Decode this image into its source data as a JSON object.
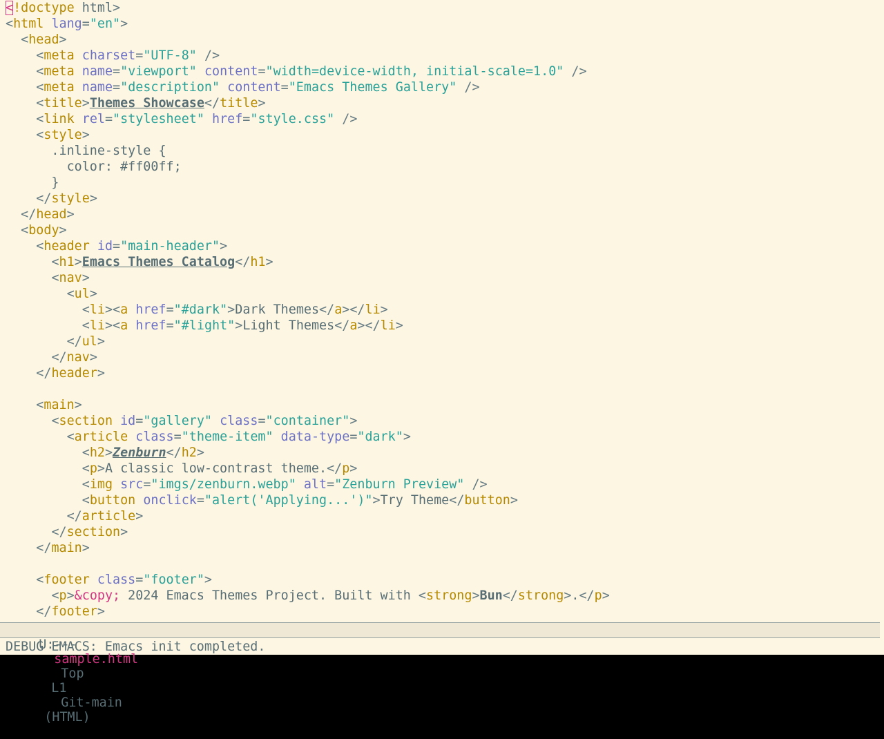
{
  "editor": {
    "lines": [
      [
        [
          "cursor",
          "<"
        ],
        [
          "tag",
          "!doctype"
        ],
        [
          "text",
          " html"
        ],
        [
          "punct",
          ">"
        ]
      ],
      [
        [
          "punct",
          "<"
        ],
        [
          "tag",
          "html"
        ],
        [
          "text",
          " "
        ],
        [
          "attr",
          "lang"
        ],
        [
          "punct",
          "="
        ],
        [
          "str",
          "\"en\""
        ],
        [
          "punct",
          ">"
        ]
      ],
      [
        [
          "text",
          "  "
        ],
        [
          "punct",
          "<"
        ],
        [
          "tag",
          "head"
        ],
        [
          "punct",
          ">"
        ]
      ],
      [
        [
          "text",
          "    "
        ],
        [
          "punct",
          "<"
        ],
        [
          "tag",
          "meta"
        ],
        [
          "text",
          " "
        ],
        [
          "attr",
          "charset"
        ],
        [
          "punct",
          "="
        ],
        [
          "str",
          "\"UTF-8\""
        ],
        [
          "text",
          " "
        ],
        [
          "punct",
          "/>"
        ]
      ],
      [
        [
          "text",
          "    "
        ],
        [
          "punct",
          "<"
        ],
        [
          "tag",
          "meta"
        ],
        [
          "text",
          " "
        ],
        [
          "attr",
          "name"
        ],
        [
          "punct",
          "="
        ],
        [
          "str",
          "\"viewport\""
        ],
        [
          "text",
          " "
        ],
        [
          "attr",
          "content"
        ],
        [
          "punct",
          "="
        ],
        [
          "str",
          "\"width=device-width, initial-scale=1.0\""
        ],
        [
          "text",
          " "
        ],
        [
          "punct",
          "/>"
        ]
      ],
      [
        [
          "text",
          "    "
        ],
        [
          "punct",
          "<"
        ],
        [
          "tag",
          "meta"
        ],
        [
          "text",
          " "
        ],
        [
          "attr",
          "name"
        ],
        [
          "punct",
          "="
        ],
        [
          "str",
          "\"description\""
        ],
        [
          "text",
          " "
        ],
        [
          "attr",
          "content"
        ],
        [
          "punct",
          "="
        ],
        [
          "str",
          "\"Emacs Themes Gallery\""
        ],
        [
          "text",
          " "
        ],
        [
          "punct",
          "/>"
        ]
      ],
      [
        [
          "text",
          "    "
        ],
        [
          "punct",
          "<"
        ],
        [
          "tag",
          "title"
        ],
        [
          "punct",
          ">"
        ],
        [
          "bu",
          "Themes Showcase"
        ],
        [
          "punct",
          "</"
        ],
        [
          "tag",
          "title"
        ],
        [
          "punct",
          ">"
        ]
      ],
      [
        [
          "text",
          "    "
        ],
        [
          "punct",
          "<"
        ],
        [
          "tag",
          "link"
        ],
        [
          "text",
          " "
        ],
        [
          "attr",
          "rel"
        ],
        [
          "punct",
          "="
        ],
        [
          "str",
          "\"stylesheet\""
        ],
        [
          "text",
          " "
        ],
        [
          "attr",
          "href"
        ],
        [
          "punct",
          "="
        ],
        [
          "str",
          "\"style.css\""
        ],
        [
          "text",
          " "
        ],
        [
          "punct",
          "/>"
        ]
      ],
      [
        [
          "text",
          "    "
        ],
        [
          "punct",
          "<"
        ],
        [
          "tag",
          "style"
        ],
        [
          "punct",
          ">"
        ]
      ],
      [
        [
          "text",
          "      .inline-style {"
        ]
      ],
      [
        [
          "text",
          "        color: #ff00ff;"
        ]
      ],
      [
        [
          "text",
          "      }"
        ]
      ],
      [
        [
          "text",
          "    "
        ],
        [
          "punct",
          "</"
        ],
        [
          "tag",
          "style"
        ],
        [
          "punct",
          ">"
        ]
      ],
      [
        [
          "text",
          "  "
        ],
        [
          "punct",
          "</"
        ],
        [
          "tag",
          "head"
        ],
        [
          "punct",
          ">"
        ]
      ],
      [
        [
          "text",
          "  "
        ],
        [
          "punct",
          "<"
        ],
        [
          "tag",
          "body"
        ],
        [
          "punct",
          ">"
        ]
      ],
      [
        [
          "text",
          "    "
        ],
        [
          "punct",
          "<"
        ],
        [
          "tag",
          "header"
        ],
        [
          "text",
          " "
        ],
        [
          "attr",
          "id"
        ],
        [
          "punct",
          "="
        ],
        [
          "str",
          "\"main-header\""
        ],
        [
          "punct",
          ">"
        ]
      ],
      [
        [
          "text",
          "      "
        ],
        [
          "punct",
          "<"
        ],
        [
          "tag",
          "h1"
        ],
        [
          "punct",
          ">"
        ],
        [
          "bu",
          "Emacs Themes Catalog"
        ],
        [
          "punct",
          "</"
        ],
        [
          "tag",
          "h1"
        ],
        [
          "punct",
          ">"
        ]
      ],
      [
        [
          "text",
          "      "
        ],
        [
          "punct",
          "<"
        ],
        [
          "tag",
          "nav"
        ],
        [
          "punct",
          ">"
        ]
      ],
      [
        [
          "text",
          "        "
        ],
        [
          "punct",
          "<"
        ],
        [
          "tag",
          "ul"
        ],
        [
          "punct",
          ">"
        ]
      ],
      [
        [
          "text",
          "          "
        ],
        [
          "punct",
          "<"
        ],
        [
          "tag",
          "li"
        ],
        [
          "punct",
          "><"
        ],
        [
          "tag",
          "a"
        ],
        [
          "text",
          " "
        ],
        [
          "attr",
          "href"
        ],
        [
          "punct",
          "="
        ],
        [
          "str",
          "\"#dark\""
        ],
        [
          "punct",
          ">"
        ],
        [
          "text",
          "Dark Themes"
        ],
        [
          "punct",
          "</"
        ],
        [
          "tag",
          "a"
        ],
        [
          "punct",
          "></"
        ],
        [
          "tag",
          "li"
        ],
        [
          "punct",
          ">"
        ]
      ],
      [
        [
          "text",
          "          "
        ],
        [
          "punct",
          "<"
        ],
        [
          "tag",
          "li"
        ],
        [
          "punct",
          "><"
        ],
        [
          "tag",
          "a"
        ],
        [
          "text",
          " "
        ],
        [
          "attr",
          "href"
        ],
        [
          "punct",
          "="
        ],
        [
          "str",
          "\"#light\""
        ],
        [
          "punct",
          ">"
        ],
        [
          "text",
          "Light Themes"
        ],
        [
          "punct",
          "</"
        ],
        [
          "tag",
          "a"
        ],
        [
          "punct",
          "></"
        ],
        [
          "tag",
          "li"
        ],
        [
          "punct",
          ">"
        ]
      ],
      [
        [
          "text",
          "        "
        ],
        [
          "punct",
          "</"
        ],
        [
          "tag",
          "ul"
        ],
        [
          "punct",
          ">"
        ]
      ],
      [
        [
          "text",
          "      "
        ],
        [
          "punct",
          "</"
        ],
        [
          "tag",
          "nav"
        ],
        [
          "punct",
          ">"
        ]
      ],
      [
        [
          "text",
          "    "
        ],
        [
          "punct",
          "</"
        ],
        [
          "tag",
          "header"
        ],
        [
          "punct",
          ">"
        ]
      ],
      [
        [
          "text",
          ""
        ]
      ],
      [
        [
          "text",
          "    "
        ],
        [
          "punct",
          "<"
        ],
        [
          "tag",
          "main"
        ],
        [
          "punct",
          ">"
        ]
      ],
      [
        [
          "text",
          "      "
        ],
        [
          "punct",
          "<"
        ],
        [
          "tag",
          "section"
        ],
        [
          "text",
          " "
        ],
        [
          "attr",
          "id"
        ],
        [
          "punct",
          "="
        ],
        [
          "str",
          "\"gallery\""
        ],
        [
          "text",
          " "
        ],
        [
          "attr",
          "class"
        ],
        [
          "punct",
          "="
        ],
        [
          "str",
          "\"container\""
        ],
        [
          "punct",
          ">"
        ]
      ],
      [
        [
          "text",
          "        "
        ],
        [
          "punct",
          "<"
        ],
        [
          "tag",
          "article"
        ],
        [
          "text",
          " "
        ],
        [
          "attr",
          "class"
        ],
        [
          "punct",
          "="
        ],
        [
          "str",
          "\"theme-item\""
        ],
        [
          "text",
          " "
        ],
        [
          "attr",
          "data-type"
        ],
        [
          "punct",
          "="
        ],
        [
          "str",
          "\"dark\""
        ],
        [
          "punct",
          ">"
        ]
      ],
      [
        [
          "text",
          "          "
        ],
        [
          "punct",
          "<"
        ],
        [
          "tag",
          "h2"
        ],
        [
          "punct",
          ">"
        ],
        [
          "bui",
          "Zenburn"
        ],
        [
          "punct",
          "</"
        ],
        [
          "tag",
          "h2"
        ],
        [
          "punct",
          ">"
        ]
      ],
      [
        [
          "text",
          "          "
        ],
        [
          "punct",
          "<"
        ],
        [
          "tag",
          "p"
        ],
        [
          "punct",
          ">"
        ],
        [
          "text",
          "A classic low-contrast theme."
        ],
        [
          "punct",
          "</"
        ],
        [
          "tag",
          "p"
        ],
        [
          "punct",
          ">"
        ]
      ],
      [
        [
          "text",
          "          "
        ],
        [
          "punct",
          "<"
        ],
        [
          "tag",
          "img"
        ],
        [
          "text",
          " "
        ],
        [
          "attr",
          "src"
        ],
        [
          "punct",
          "="
        ],
        [
          "str",
          "\"imgs/zenburn.webp\""
        ],
        [
          "text",
          " "
        ],
        [
          "attr",
          "alt"
        ],
        [
          "punct",
          "="
        ],
        [
          "str",
          "\"Zenburn Preview\""
        ],
        [
          "text",
          " "
        ],
        [
          "punct",
          "/>"
        ]
      ],
      [
        [
          "text",
          "          "
        ],
        [
          "punct",
          "<"
        ],
        [
          "tag",
          "button"
        ],
        [
          "text",
          " "
        ],
        [
          "attr",
          "onclick"
        ],
        [
          "punct",
          "="
        ],
        [
          "str",
          "\"alert('Applying...')\""
        ],
        [
          "punct",
          ">"
        ],
        [
          "text",
          "Try Theme"
        ],
        [
          "punct",
          "</"
        ],
        [
          "tag",
          "button"
        ],
        [
          "punct",
          ">"
        ]
      ],
      [
        [
          "text",
          "        "
        ],
        [
          "punct",
          "</"
        ],
        [
          "tag",
          "article"
        ],
        [
          "punct",
          ">"
        ]
      ],
      [
        [
          "text",
          "      "
        ],
        [
          "punct",
          "</"
        ],
        [
          "tag",
          "section"
        ],
        [
          "punct",
          ">"
        ]
      ],
      [
        [
          "text",
          "    "
        ],
        [
          "punct",
          "</"
        ],
        [
          "tag",
          "main"
        ],
        [
          "punct",
          ">"
        ]
      ],
      [
        [
          "text",
          ""
        ]
      ],
      [
        [
          "text",
          "    "
        ],
        [
          "punct",
          "<"
        ],
        [
          "tag",
          "footer"
        ],
        [
          "text",
          " "
        ],
        [
          "attr",
          "class"
        ],
        [
          "punct",
          "="
        ],
        [
          "str",
          "\"footer\""
        ],
        [
          "punct",
          ">"
        ]
      ],
      [
        [
          "text",
          "      "
        ],
        [
          "punct",
          "<"
        ],
        [
          "tag",
          "p"
        ],
        [
          "punct",
          ">"
        ],
        [
          "ent",
          "&copy;"
        ],
        [
          "text",
          " 2024 Emacs Themes Project. Built with "
        ],
        [
          "punct",
          "<"
        ],
        [
          "tag",
          "strong"
        ],
        [
          "punct",
          ">"
        ],
        [
          "b",
          "Bun"
        ],
        [
          "punct",
          "</"
        ],
        [
          "tag",
          "strong"
        ],
        [
          "punct",
          ">"
        ],
        [
          "text",
          "."
        ],
        [
          "punct",
          "</"
        ],
        [
          "tag",
          "p"
        ],
        [
          "punct",
          ">"
        ]
      ],
      [
        [
          "text",
          "    "
        ],
        [
          "punct",
          "</"
        ],
        [
          "tag",
          "footer"
        ],
        [
          "punct",
          ">"
        ]
      ]
    ]
  },
  "modeline": {
    "status": "U:---",
    "filename": "sample.html",
    "position": "Top",
    "line": "L1",
    "vc": "Git-main",
    "mode": "(HTML)"
  },
  "echo_area": {
    "message": "DEBUG EMACS: Emacs init completed."
  },
  "colors": {
    "background": "#fdf6e3",
    "tag": "#b58900",
    "attribute": "#6c71c4",
    "string": "#2aa198",
    "entity": "#d33682",
    "text": "#586e75"
  }
}
